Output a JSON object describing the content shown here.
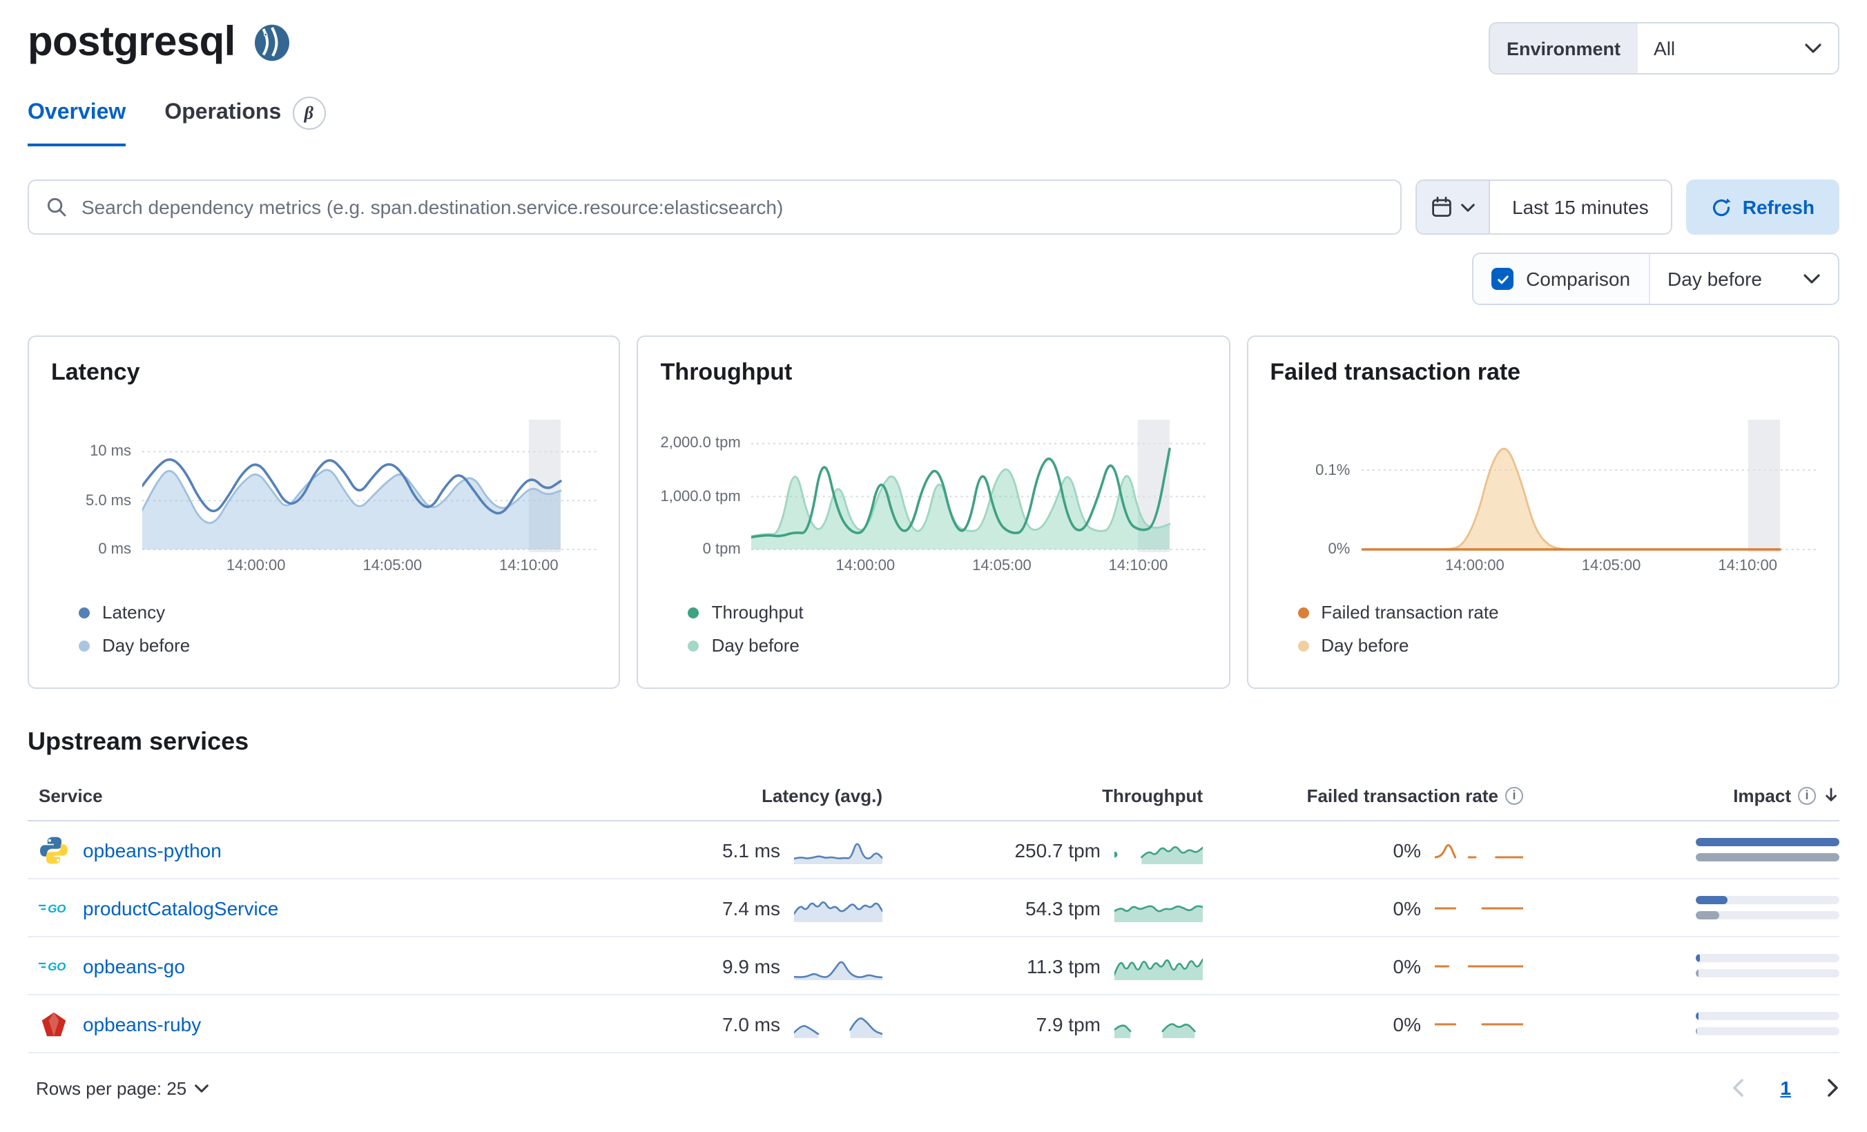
{
  "header": {
    "title": "postgresql",
    "env_label": "Environment",
    "env_value": "All"
  },
  "tabs": [
    {
      "label": "Overview",
      "active": true
    },
    {
      "label": "Operations",
      "badge": "β"
    }
  ],
  "search": {
    "placeholder": "Search dependency metrics (e.g. span.destination.service.resource:elasticsearch)",
    "time_range": "Last 15 minutes",
    "refresh_label": "Refresh"
  },
  "comparison": {
    "label": "Comparison",
    "value": "Day before",
    "checked": true
  },
  "colors": {
    "primary": "#0061c5",
    "latency": "#5581b8",
    "throughput": "#3fa184",
    "failed_rate": "#d98038"
  },
  "chart_data": {
    "latency": {
      "title": "Latency",
      "type": "line",
      "unit": "ms",
      "ymax": 13,
      "xspan": 0.92,
      "band": [
        0.85,
        0.92
      ],
      "y_ticks": [
        {
          "label": "10 ms",
          "v": 10
        },
        {
          "label": "5.0 ms",
          "v": 5
        },
        {
          "label": "0 ms",
          "v": 0
        }
      ],
      "x_ticks": [
        {
          "label": "14:00:00",
          "p": 0.25
        },
        {
          "label": "14:05:00",
          "p": 0.55
        },
        {
          "label": "14:10:00",
          "p": 0.85
        }
      ],
      "series": [
        {
          "name": "Day before",
          "color": "#9fc0de",
          "fill": "rgba(158,192,224,0.45)",
          "width": 1.4,
          "values": [
            4,
            7,
            8.5,
            6,
            3,
            2.5,
            5,
            7,
            8,
            6,
            4,
            6,
            7.5,
            8.5,
            6,
            4,
            5.5,
            7,
            8,
            6,
            4,
            5,
            7,
            7.5,
            5,
            4,
            5,
            6.5,
            5.5,
            6
          ]
        },
        {
          "name": "Latency",
          "color": "#5581b8",
          "fill": "none",
          "width": 1.8,
          "values": [
            6.5,
            8.5,
            9.5,
            8,
            5,
            3.5,
            5.5,
            8,
            9,
            7,
            4.5,
            5,
            8,
            9.5,
            8,
            5.5,
            7.5,
            9,
            8,
            5,
            4,
            6.5,
            8,
            6,
            4,
            3.5,
            6,
            7.5,
            6,
            7
          ]
        }
      ],
      "legend": [
        {
          "label": "Latency",
          "color": "#5581b8"
        },
        {
          "label": "Day before",
          "color": "#a9c6e0"
        }
      ]
    },
    "throughput": {
      "title": "Throughput",
      "type": "line",
      "unit": "tpm",
      "ymax": 2400,
      "xspan": 0.92,
      "band": [
        0.85,
        0.92
      ],
      "y_ticks": [
        {
          "label": "2,000.0 tpm",
          "v": 2000
        },
        {
          "label": "1,000.0 tpm",
          "v": 1000
        },
        {
          "label": "0 tpm",
          "v": 0
        }
      ],
      "x_ticks": [
        {
          "label": "14:00:00",
          "p": 0.25
        },
        {
          "label": "14:05:00",
          "p": 0.55
        },
        {
          "label": "14:10:00",
          "p": 0.85
        }
      ],
      "series": [
        {
          "name": "Day before",
          "color": "#9ed6c2",
          "fill": "rgba(140,210,185,0.45)",
          "width": 1.4,
          "values": [
            250,
            300,
            280,
            1700,
            500,
            300,
            1400,
            420,
            330,
            1200,
            1500,
            380,
            320,
            1500,
            480,
            330,
            380,
            1400,
            1600,
            430,
            330,
            800,
            1600,
            480,
            330,
            380,
            1700,
            520,
            380,
            480
          ]
        },
        {
          "name": "Throughput",
          "color": "#3fa184",
          "fill": "none",
          "width": 1.8,
          "values": [
            230,
            280,
            240,
            330,
            290,
            1900,
            680,
            290,
            340,
            1500,
            430,
            290,
            1300,
            1600,
            430,
            290,
            1700,
            530,
            290,
            340,
            1600,
            1800,
            480,
            290,
            950,
            1850,
            530,
            340,
            430,
            1900
          ]
        }
      ],
      "legend": [
        {
          "label": "Throughput",
          "color": "#3fa184"
        },
        {
          "label": "Day before",
          "color": "#a4d8c6"
        }
      ]
    },
    "failed_rate": {
      "title": "Failed transaction rate",
      "type": "line",
      "unit": "%",
      "ymax": 0.16,
      "xspan": 0.92,
      "band": [
        0.85,
        0.92
      ],
      "y_ticks": [
        {
          "label": "0.1%",
          "v": 0.1
        },
        {
          "label": "0%",
          "v": 0
        }
      ],
      "x_ticks": [
        {
          "label": "14:00:00",
          "p": 0.25
        },
        {
          "label": "14:05:00",
          "p": 0.55
        },
        {
          "label": "14:10:00",
          "p": 0.85
        }
      ],
      "series": [
        {
          "name": "Day before",
          "color": "#ecc08b",
          "fill": "rgba(243,205,150,0.55)",
          "width": 1.4,
          "values": [
            0,
            0,
            0,
            0,
            0,
            0,
            0,
            0.004,
            0.04,
            0.11,
            0.135,
            0.09,
            0.025,
            0.004,
            0,
            0,
            0,
            0,
            0,
            0,
            0,
            0,
            0,
            0,
            0,
            0,
            0,
            0,
            0,
            0
          ]
        },
        {
          "name": "Failed transaction rate",
          "color": "#d98038",
          "fill": "none",
          "width": 1.8,
          "values": [
            0,
            0,
            0,
            0,
            0,
            0,
            0,
            0,
            0,
            0,
            0,
            0,
            0,
            0,
            0,
            0,
            0,
            0,
            0,
            0,
            0,
            0,
            0,
            0,
            0,
            0,
            0,
            0,
            0,
            0
          ]
        }
      ],
      "legend": [
        {
          "label": "Failed transaction rate",
          "color": "#d98038"
        },
        {
          "label": "Day before",
          "color": "#f0cfa0"
        }
      ]
    }
  },
  "upstream": {
    "title": "Upstream services",
    "columns": [
      "Service",
      "Latency (avg.)",
      "Throughput",
      "Failed transaction rate",
      "Impact"
    ],
    "rows": [
      {
        "name": "opbeans-python",
        "icon": "python",
        "latency": "5.1 ms",
        "throughput": "250.7 tpm",
        "failed": "0%",
        "impact": {
          "current": 100,
          "previous": 100
        },
        "sparklines": {
          "latency": {
            "ymax": 10,
            "series": [
              {
                "color": "#5581b8",
                "fill": "rgba(109,152,200,0.25)",
                "width": 1.3,
                "values": [
                  2,
                  2.6,
                  2,
                  2.4,
                  3,
                  2.2,
                  2.6,
                  2,
                  2.3,
                  2,
                  9,
                  2.5,
                  1.8,
                  4.5,
                  2.2
                ]
              }
            ]
          },
          "throughput": {
            "ymax": 10,
            "series": [
              {
                "color": "#3fa184",
                "fill": "rgba(84,179,153,0.4)",
                "width": 1.3,
                "values": [
                  3.5,
                  null,
                  null,
                  null,
                  2.5,
                  5,
                  3,
                  6.5,
                  4,
                  7,
                  3.5,
                  5.5,
                  4,
                  6
                ]
              }
            ]
          },
          "failed": {
            "ymax": 6,
            "series": [
              {
                "color": "#d98038",
                "fill": "none",
                "width": 1.5,
                "values": [
                  1.5,
                  1.5,
                  5,
                  1.5,
                  null,
                  1.5,
                  1.5,
                  null,
                  null,
                  1.5,
                  1.5,
                  1.5,
                  1.5,
                  1.5
                ]
              }
            ]
          }
        }
      },
      {
        "name": "productCatalogService",
        "icon": "go",
        "latency": "7.4 ms",
        "throughput": "54.3 tpm",
        "failed": "0%",
        "impact": {
          "current": 22,
          "previous": 16
        },
        "sparklines": {
          "latency": {
            "ymax": 10,
            "series": [
              {
                "color": "#5581b8",
                "fill": "rgba(109,152,200,0.25)",
                "width": 1.3,
                "values": [
                  3,
                  6.5,
                  4,
                  7.5,
                  5,
                  8,
                  4.5,
                  6,
                  3.5,
                  5,
                  7,
                  4,
                  6.5,
                  5,
                  7.5,
                  4
                ]
              }
            ]
          },
          "throughput": {
            "ymax": 10,
            "series": [
              {
                "color": "#3fa184",
                "fill": "rgba(84,179,153,0.4)",
                "width": 1.3,
                "values": [
                  4,
                  5.5,
                  3.5,
                  6,
                  4.5,
                  5.5,
                  6,
                  3.5,
                  5,
                  4.5,
                  6,
                  5,
                  4,
                  6,
                  5.5
                ]
              }
            ]
          },
          "failed": {
            "ymax": 3,
            "series": [
              {
                "color": "#d98038",
                "fill": "none",
                "width": 1.5,
                "values": [
                  1.5,
                  1.5,
                  1.5,
                  1.5,
                  null,
                  null,
                  null,
                  1.5,
                  1.5,
                  1.5,
                  1.5,
                  1.5,
                  1.5,
                  1.5
                ]
              }
            ]
          }
        }
      },
      {
        "name": "opbeans-go",
        "icon": "go",
        "latency": "9.9 ms",
        "throughput": "11.3 tpm",
        "failed": "0%",
        "impact": {
          "current": 3,
          "previous": 2
        },
        "sparklines": {
          "latency": {
            "ymax": 10,
            "series": [
              {
                "color": "#5581b8",
                "fill": "rgba(109,152,200,0.25)",
                "width": 1.3,
                "values": [
                  1.2,
                  1,
                  1.4,
                  2.5,
                  1.2,
                  1,
                  4,
                  7.5,
                  3,
                  1.2,
                  1,
                  2,
                  1.2,
                  1
                ]
              }
            ]
          },
          "throughput": {
            "ymax": 10,
            "series": [
              {
                "color": "#3fa184",
                "fill": "rgba(84,179,153,0.4)",
                "width": 1.3,
                "values": [
                  2,
                  8,
                  3,
                  7.5,
                  2.5,
                  8,
                  3,
                  7,
                  4,
                  8.5,
                  2.5,
                  7,
                  3,
                  8,
                  4,
                  7.5
                ]
              }
            ]
          },
          "failed": {
            "ymax": 3,
            "series": [
              {
                "color": "#d98038",
                "fill": "none",
                "width": 1.5,
                "values": [
                  1.5,
                  1.5,
                  1.5,
                  null,
                  null,
                  1.5,
                  1.5,
                  1.5,
                  1.5,
                  1.5,
                  1.5,
                  1.5,
                  1.5,
                  1.5
                ]
              }
            ]
          }
        }
      },
      {
        "name": "opbeans-ruby",
        "icon": "ruby",
        "latency": "7.0 ms",
        "throughput": "7.9 tpm",
        "failed": "0%",
        "impact": {
          "current": 2,
          "previous": 1
        },
        "sparklines": {
          "latency": {
            "ymax": 10,
            "series": [
              {
                "color": "#5581b8",
                "fill": "rgba(109,152,200,0.25)",
                "width": 1.3,
                "values": [
                  2,
                  5,
                  3.5,
                  1.5,
                  null,
                  null,
                  null,
                  3,
                  8,
                  6,
                  2.5,
                  1.5
                ]
              }
            ]
          },
          "throughput": {
            "ymax": 10,
            "series": [
              {
                "color": "#3fa184",
                "fill": "rgba(84,179,153,0.4)",
                "width": 1.3,
                "values": [
                  3,
                  5.5,
                  2.5,
                  null,
                  null,
                  null,
                  2.5,
                  6,
                  3.5,
                  5.5,
                  2.5,
                  null
                ]
              }
            ]
          },
          "failed": {
            "ymax": 3,
            "series": [
              {
                "color": "#d98038",
                "fill": "none",
                "width": 1.5,
                "values": [
                  1.5,
                  1.5,
                  1.5,
                  1.5,
                  null,
                  null,
                  null,
                  1.5,
                  1.5,
                  1.5,
                  1.5,
                  1.5,
                  1.5,
                  1.5
                ]
              }
            ]
          }
        }
      }
    ]
  },
  "pagination": {
    "rows_per_page": "Rows per page: 25",
    "page": "1"
  }
}
